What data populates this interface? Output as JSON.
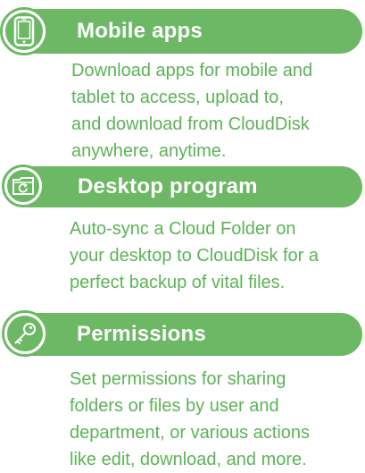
{
  "features": [
    {
      "title": "Mobile apps",
      "icon": "mobile-phone-icon",
      "lines": [
        "Download apps for mobile and",
        "tablet to access, upload to,",
        "and download from CloudDisk",
        "anywhere, anytime."
      ]
    },
    {
      "title": "Desktop program",
      "icon": "desktop-sync-folder-icon",
      "lines": [
        "Auto-sync a Cloud Folder on",
        "your desktop to CloudDisk for a",
        "perfect backup of vital files."
      ]
    },
    {
      "title": "Permissions",
      "icon": "key-icon",
      "lines": [
        "Set permissions for sharing",
        "folders or files by user and",
        "department, or various actions",
        "like edit, download, and more."
      ]
    }
  ],
  "colors": {
    "accent_green": "#6cb865",
    "text_green": "#5cb357",
    "background": "#ffffff"
  }
}
